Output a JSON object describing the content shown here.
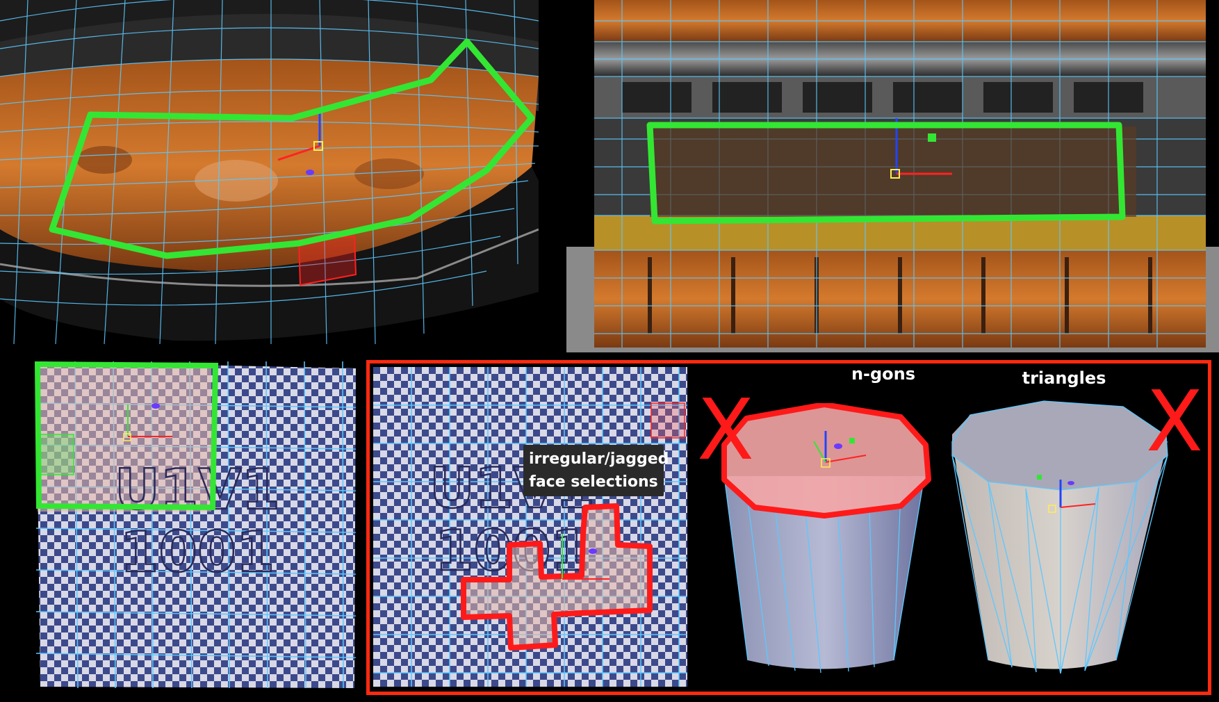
{
  "labels": {
    "ngons": "n-gons",
    "triangles": "triangles",
    "tooltip_line1": "irregular/jagged",
    "tooltip_line2": "face selections",
    "x_mark": "X"
  },
  "uv_tiles": [
    {
      "line1": "U1V1",
      "line2": "1001"
    },
    {
      "line1": "U1V1",
      "line2": "1001"
    }
  ],
  "colors": {
    "good_selection": "#33e633",
    "bad_selection": "#ff1a1a",
    "wireframe": "#5cc8ff",
    "rust_orange": "#c86a22",
    "background": "#000000"
  }
}
